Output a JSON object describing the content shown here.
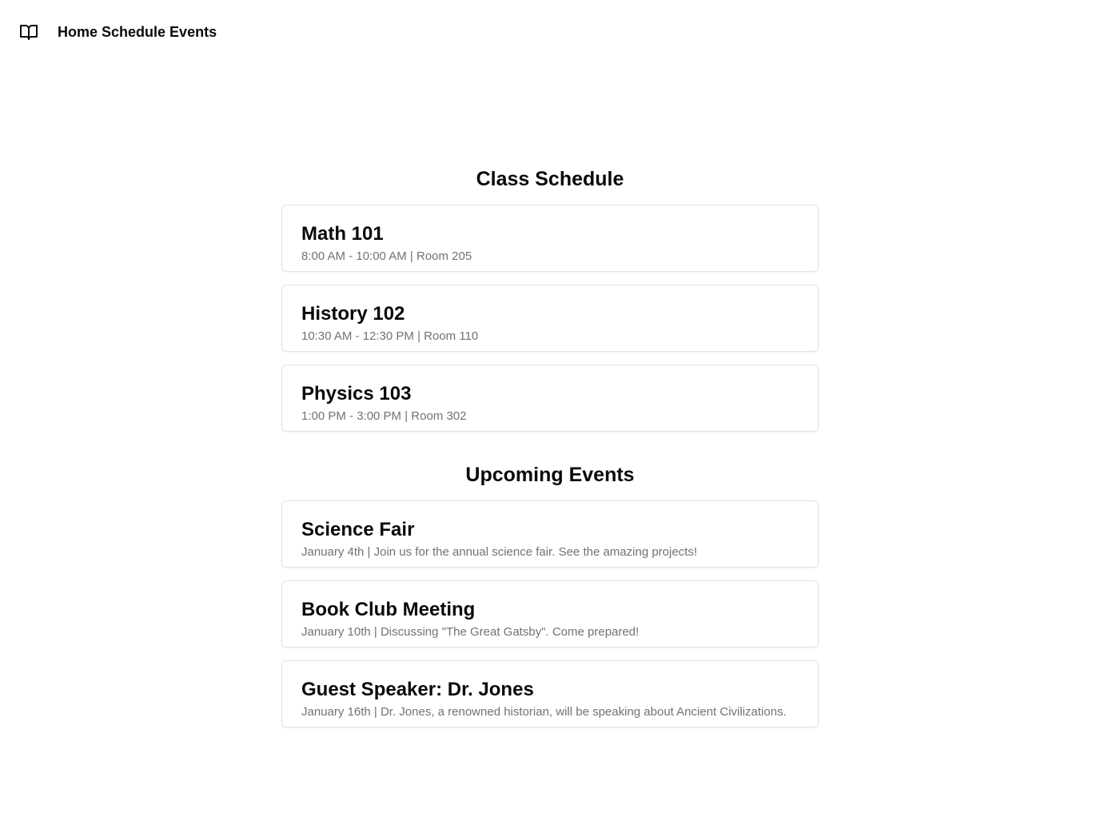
{
  "nav": {
    "icon": "book-open-icon",
    "links": [
      "Home",
      "Schedule",
      "Events"
    ]
  },
  "schedule": {
    "title": "Class Schedule",
    "items": [
      {
        "title": "Math 101",
        "meta": "8:00 AM - 10:00 AM | Room 205"
      },
      {
        "title": "History 102",
        "meta": "10:30 AM - 12:30 PM | Room 110"
      },
      {
        "title": "Physics 103",
        "meta": "1:00 PM - 3:00 PM | Room 302"
      }
    ]
  },
  "events": {
    "title": "Upcoming Events",
    "items": [
      {
        "title": "Science Fair",
        "meta": "January 4th | Join us for the annual science fair. See the amazing projects!"
      },
      {
        "title": "Book Club Meeting",
        "meta": "January 10th | Discussing \"The Great Gatsby\". Come prepared!"
      },
      {
        "title": "Guest Speaker: Dr. Jones",
        "meta": "January 16th | Dr. Jones, a renowned historian, will be speaking about Ancient Civilizations."
      }
    ]
  },
  "colors": {
    "text": "#0a0a0a",
    "muted": "#71717a",
    "border": "#e4e4e7"
  }
}
